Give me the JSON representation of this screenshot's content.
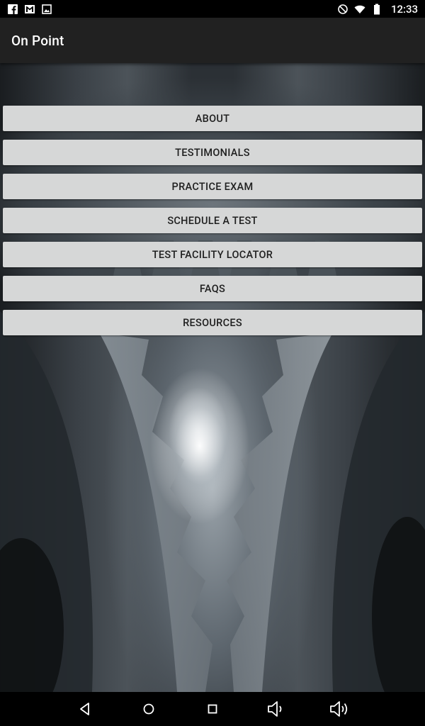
{
  "status_bar": {
    "time": "12:33",
    "left_icons": [
      "facebook-icon",
      "gmail-icon",
      "image-icon"
    ],
    "right_icons": [
      "do-not-disturb-icon",
      "wifi-icon",
      "battery-icon"
    ]
  },
  "app_bar": {
    "title": "On Point"
  },
  "menu": {
    "items": [
      {
        "label": "ABOUT"
      },
      {
        "label": "TESTIMONIALS"
      },
      {
        "label": "PRACTICE EXAM"
      },
      {
        "label": "SCHEDULE A TEST"
      },
      {
        "label": "TEST FACILITY LOCATOR"
      },
      {
        "label": "FAQS"
      },
      {
        "label": "RESOURCES"
      }
    ]
  },
  "nav_bar": {
    "buttons": [
      "back-icon",
      "home-icon",
      "recents-icon",
      "volume-down-icon",
      "volume-up-icon"
    ]
  },
  "colors": {
    "app_bar": "#212121",
    "button_bg": "#d6d7d7",
    "button_text": "#1f1f1f"
  }
}
